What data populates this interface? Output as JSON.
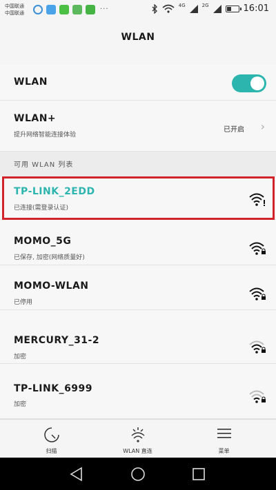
{
  "status_bar": {
    "carrier_1": "中国联通",
    "carrier_2": "中国联通",
    "more": "···",
    "network_4g": "4G",
    "network_2g": "2G",
    "time": "16:01",
    "battery_level": 0.45
  },
  "title": "WLAN",
  "cut_label": "· ·",
  "wlan_toggle": {
    "label": "WLAN",
    "on": true
  },
  "wlan_plus": {
    "title": "WLAN+",
    "subtitle": "提升网络智能连接体验",
    "status": "已开启"
  },
  "section_header": "可用 WLAN 列表",
  "networks": [
    {
      "name": "TP-LINK_2EDD",
      "status": "已连接(需登录认证)",
      "connected": true,
      "signal": 4
    },
    {
      "name": "MOMO_5G",
      "status": "已保存, 加密(网络质量好)",
      "connected": false,
      "signal": 4
    },
    {
      "name": "MOMO-WLAN",
      "status": "已停用",
      "connected": false,
      "signal": 4
    },
    {
      "name": "MERCURY_31-2",
      "status": "加密",
      "connected": false,
      "signal": 3
    },
    {
      "name": "TP-LINK_6999",
      "status": "加密",
      "connected": false,
      "signal": 2
    }
  ],
  "toolbar": {
    "scan": "扫描",
    "wlan_direct": "WLAN 直连",
    "menu": "菜单"
  },
  "colors": {
    "accent": "#2bb5ae",
    "highlight": "#d2232a"
  }
}
